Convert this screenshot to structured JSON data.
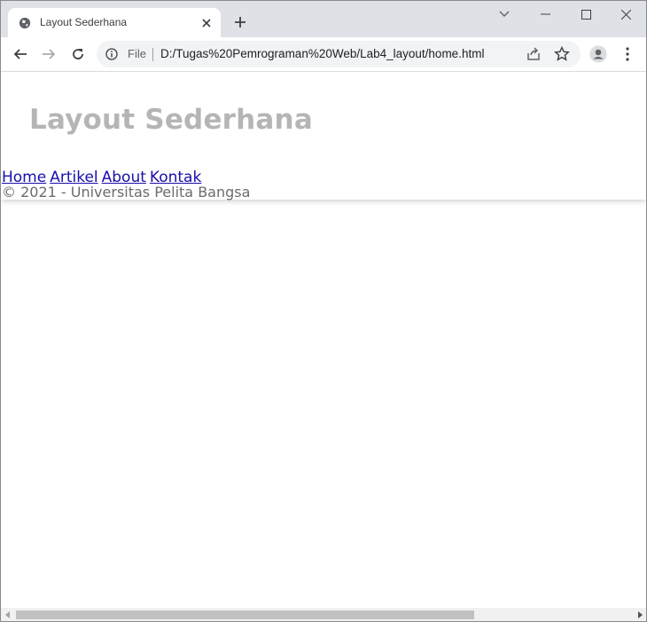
{
  "browser": {
    "tab": {
      "title": "Layout Sederhana"
    },
    "address": {
      "scheme_label": "File",
      "url": "D:/Tugas%20Pemrograman%20Web/Lab4_layout/home.html"
    }
  },
  "page": {
    "title": "Layout Sederhana",
    "nav": [
      {
        "label": "Home"
      },
      {
        "label": "Artikel"
      },
      {
        "label": "About"
      },
      {
        "label": "Kontak"
      }
    ],
    "footer": "© 2021 - Universitas Pelita Bangsa"
  },
  "colors": {
    "tabstrip": "#dee1e6",
    "title_gray": "#b5b5b5",
    "link": "#1a0dab",
    "footer_text": "#6b6b6b"
  }
}
